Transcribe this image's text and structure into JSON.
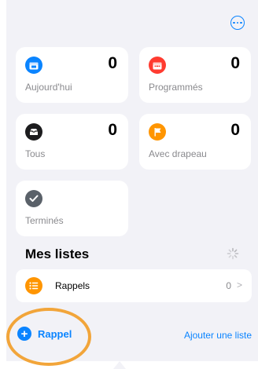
{
  "header": {
    "more_icon": "ellipsis-circle-icon"
  },
  "smart_lists": [
    {
      "id": "today",
      "label": "Aujourd'hui",
      "count": "0",
      "icon": "calendar-icon",
      "color": "#0a84ff"
    },
    {
      "id": "scheduled",
      "label": "Programmés",
      "count": "0",
      "icon": "calendar-icon",
      "color": "#ff3b30"
    },
    {
      "id": "all",
      "label": "Tous",
      "count": "0",
      "icon": "tray-icon",
      "color": "#1c1c1e"
    },
    {
      "id": "flagged",
      "label": "Avec drapeau",
      "count": "0",
      "icon": "flag-icon",
      "color": "#ff9500"
    },
    {
      "id": "completed",
      "label": "Terminés",
      "icon": "checkmark-icon",
      "color": "#5a6169"
    }
  ],
  "my_lists": {
    "title": "Mes listes",
    "items": [
      {
        "name": "Rappels",
        "count": "0",
        "icon": "list-bullet-icon",
        "color": "#ff9500"
      }
    ]
  },
  "footer": {
    "add_reminder_label": "Rappel",
    "add_list_label": "Ajouter une liste"
  }
}
